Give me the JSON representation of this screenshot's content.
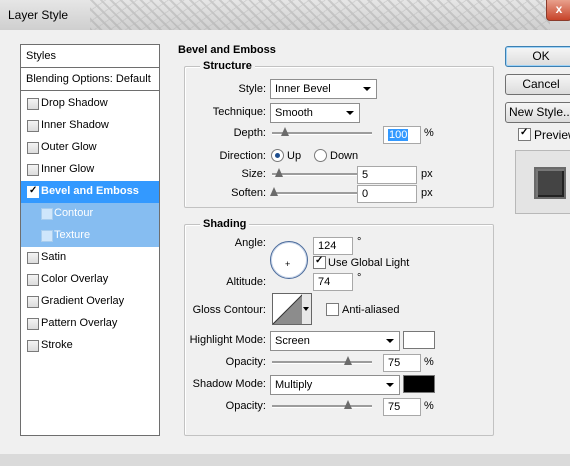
{
  "window": {
    "title": "Layer Style",
    "close": "x"
  },
  "styles_panel": {
    "header": "Styles",
    "blending": "Blending Options: Default",
    "items": [
      {
        "label": "Drop Shadow",
        "checked": false
      },
      {
        "label": "Inner Shadow",
        "checked": false
      },
      {
        "label": "Outer Glow",
        "checked": false
      },
      {
        "label": "Inner Glow",
        "checked": false
      },
      {
        "label": "Bevel and Emboss",
        "checked": true,
        "selected": true
      },
      {
        "label": "Contour",
        "checked": false,
        "sub": true
      },
      {
        "label": "Texture",
        "checked": false,
        "sub": true
      },
      {
        "label": "Satin",
        "checked": false
      },
      {
        "label": "Color Overlay",
        "checked": false
      },
      {
        "label": "Gradient Overlay",
        "checked": false
      },
      {
        "label": "Pattern Overlay",
        "checked": false
      },
      {
        "label": "Stroke",
        "checked": false
      }
    ]
  },
  "bevel": {
    "section_title": "Bevel and Emboss",
    "structure": {
      "title": "Structure",
      "style_label": "Style:",
      "style_value": "Inner Bevel",
      "technique_label": "Technique:",
      "technique_value": "Smooth",
      "depth_label": "Depth:",
      "depth_value": "100",
      "depth_unit": "%",
      "direction_label": "Direction:",
      "direction_up": "Up",
      "direction_down": "Down",
      "direction_selected": "Up",
      "size_label": "Size:",
      "size_value": "5",
      "size_unit": "px",
      "soften_label": "Soften:",
      "soften_value": "0",
      "soften_unit": "px"
    },
    "shading": {
      "title": "Shading",
      "angle_label": "Angle:",
      "angle_value": "124",
      "angle_unit": "°",
      "use_global_light": "Use Global Light",
      "use_global_light_checked": true,
      "altitude_label": "Altitude:",
      "altitude_value": "74",
      "altitude_unit": "°",
      "gloss_label": "Gloss Contour:",
      "anti_aliased": "Anti-aliased",
      "anti_aliased_checked": false,
      "highlight_label": "Highlight Mode:",
      "highlight_value": "Screen",
      "highlight_color": "#ffffff",
      "highlight_opacity_label": "Opacity:",
      "highlight_opacity": "75",
      "highlight_opacity_unit": "%",
      "shadow_label": "Shadow Mode:",
      "shadow_value": "Multiply",
      "shadow_color": "#000000",
      "shadow_opacity_label": "Opacity:",
      "shadow_opacity": "75",
      "shadow_opacity_unit": "%"
    }
  },
  "buttons": {
    "ok": "OK",
    "cancel": "Cancel",
    "new_style": "New Style...",
    "preview": "Preview",
    "preview_checked": true
  },
  "colors": {
    "selection": "#3399ff",
    "sub_selection": "#86bdf1"
  }
}
